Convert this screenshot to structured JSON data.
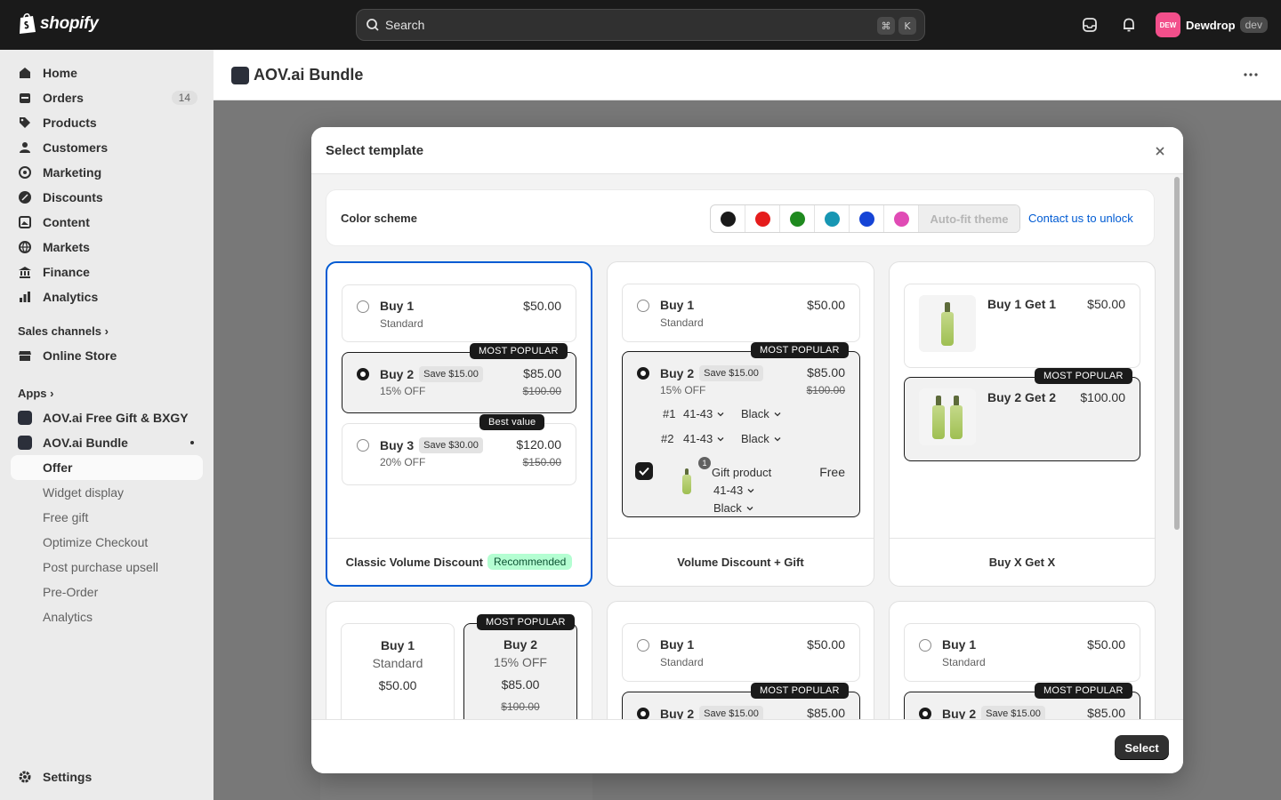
{
  "topbar": {
    "brand": "shopify",
    "search_placeholder": "Search",
    "shortcut_cmd": "⌘",
    "shortcut_key": "K",
    "store_initials": "DEW",
    "store_name": "Dewdrop",
    "store_tag": "dev"
  },
  "sidebar": {
    "items": [
      {
        "label": "Home",
        "icon": "home-icon"
      },
      {
        "label": "Orders",
        "icon": "orders-icon",
        "badge": "14"
      },
      {
        "label": "Products",
        "icon": "tag-icon"
      },
      {
        "label": "Customers",
        "icon": "person-icon"
      },
      {
        "label": "Marketing",
        "icon": "target-icon"
      },
      {
        "label": "Discounts",
        "icon": "discount-icon"
      },
      {
        "label": "Content",
        "icon": "content-icon"
      },
      {
        "label": "Markets",
        "icon": "globe-icon"
      },
      {
        "label": "Finance",
        "icon": "bank-icon"
      },
      {
        "label": "Analytics",
        "icon": "chart-icon"
      }
    ],
    "sales_channels_label": "Sales channels",
    "online_store": "Online Store",
    "apps_label": "Apps",
    "app_free_gift": "AOV.ai Free Gift & BXGY",
    "app_bundle": "AOV.ai Bundle",
    "bundle_sub": [
      "Offer",
      "Widget display",
      "Free gift",
      "Optimize Checkout",
      "Post purchase upsell",
      "Pre-Order",
      "Analytics"
    ],
    "settings": "Settings"
  },
  "main": {
    "app_title": "AOV.ai Bundle"
  },
  "modal": {
    "title": "Select template",
    "color_scheme_label": "Color scheme",
    "swatches": [
      "#1a1a1a",
      "#e51c1c",
      "#1f8a1f",
      "#1796b3",
      "#1544d6",
      "#e04bb5"
    ],
    "auto_fit": "Auto-fit theme",
    "contact": "Contact us to unlock",
    "select_button": "Select",
    "card1": {
      "footer": "Classic Volume Discount",
      "badge": "Recommended",
      "o1": {
        "title": "Buy 1",
        "sub": "Standard",
        "price": "$50.00"
      },
      "o2": {
        "title": "Buy 2",
        "save": "Save $15.00",
        "sub": "15% OFF",
        "price": "$85.00",
        "strike": "$100.00",
        "tag": "MOST POPULAR"
      },
      "o3": {
        "title": "Buy 3",
        "save": "Save $30.00",
        "sub": "20% OFF",
        "price": "$120.00",
        "strike": "$150.00",
        "tag": "Best value"
      }
    },
    "card2": {
      "footer": "Volume Discount + Gift",
      "o1": {
        "title": "Buy 1",
        "sub": "Standard",
        "price": "$50.00"
      },
      "o2": {
        "title": "Buy 2",
        "save": "Save $15.00",
        "sub": "15% OFF",
        "price": "$85.00",
        "strike": "$100.00",
        "tag": "MOST POPULAR"
      },
      "v1_num": "#1",
      "v1_size": "41-43",
      "v1_color": "Black",
      "v2_num": "#2",
      "v2_size": "41-43",
      "v2_color": "Black",
      "gift_count": "1",
      "gift_label": "Gift product",
      "gift_price": "Free",
      "gift_size": "41-43",
      "gift_color": "Black"
    },
    "card3": {
      "footer": "Buy X Get X",
      "o1": {
        "title": "Buy 1 Get 1",
        "price": "$50.00"
      },
      "o2": {
        "title": "Buy 2 Get 2",
        "price": "$100.00",
        "tag": "MOST POPULAR"
      }
    },
    "card4": {
      "o1": {
        "title": "Buy 1",
        "sub": "Standard",
        "price": "$50.00"
      },
      "o2": {
        "title": "Buy 2",
        "sub": "15% OFF",
        "price": "$85.00",
        "strike": "$100.00",
        "tag": "MOST POPULAR"
      }
    },
    "card5": {
      "o1": {
        "title": "Buy 1",
        "sub": "Standard",
        "price": "$50.00"
      },
      "o2": {
        "title": "Buy 2",
        "save": "Save $15.00",
        "price": "$85.00",
        "tag": "MOST POPULAR"
      }
    },
    "card6": {
      "o1": {
        "title": "Buy 1",
        "sub": "Standard",
        "price": "$50.00"
      },
      "o2": {
        "title": "Buy 2",
        "save": "Save $15.00",
        "price": "$85.00",
        "tag": "MOST POPULAR"
      }
    }
  }
}
